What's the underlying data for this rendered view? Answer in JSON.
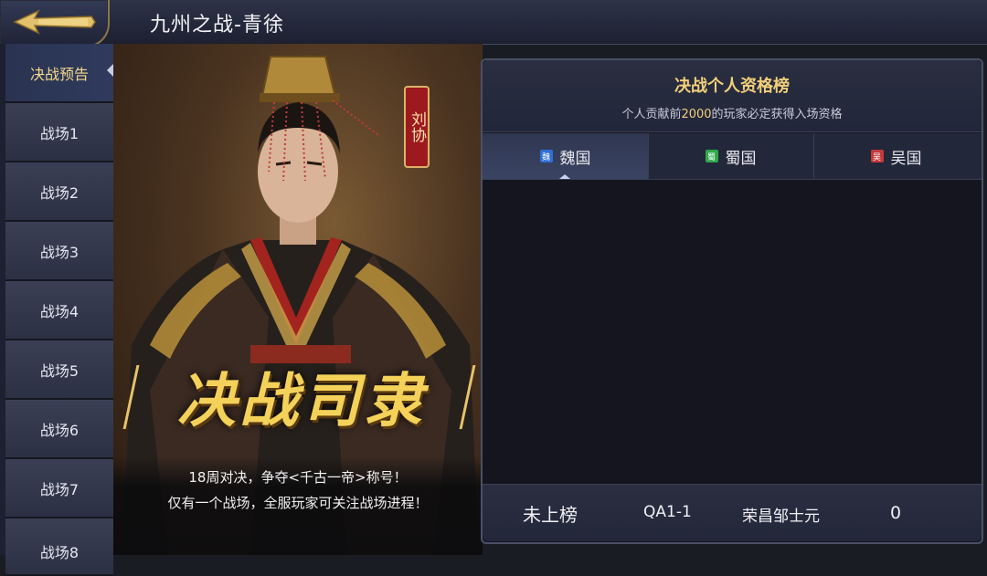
{
  "header": {
    "title": "九州之战-青徐"
  },
  "sidebar": {
    "items": [
      {
        "label": "决战预告",
        "active": true
      },
      {
        "label": "战场1"
      },
      {
        "label": "战场2"
      },
      {
        "label": "战场3"
      },
      {
        "label": "战场4"
      },
      {
        "label": "战场5"
      },
      {
        "label": "战场6"
      },
      {
        "label": "战场7"
      },
      {
        "label": "战场8"
      }
    ]
  },
  "banner": {
    "character_seal": "刘协",
    "title": "决战司隶",
    "caption_line1": "18周对决，争夺<千古一帝>称号！",
    "caption_line2": "仅有一个战场，全服玩家可关注战场进程！"
  },
  "ranking": {
    "title": "决战个人资格榜",
    "subtitle_pre": "个人贡献前",
    "subtitle_highlight": "2000",
    "subtitle_post": "的玩家必定获得入场资格",
    "tabs": [
      {
        "label": "魏国",
        "flag": "魏",
        "color": "#2f6fd6",
        "active": true
      },
      {
        "label": "蜀国",
        "flag": "蜀",
        "color": "#2fa84a"
      },
      {
        "label": "吴国",
        "flag": "吴",
        "color": "#c33a3a"
      }
    ],
    "footer": {
      "rank": "未上榜",
      "server": "QA1-1",
      "player": "荣昌邹士元",
      "score": "0"
    }
  }
}
